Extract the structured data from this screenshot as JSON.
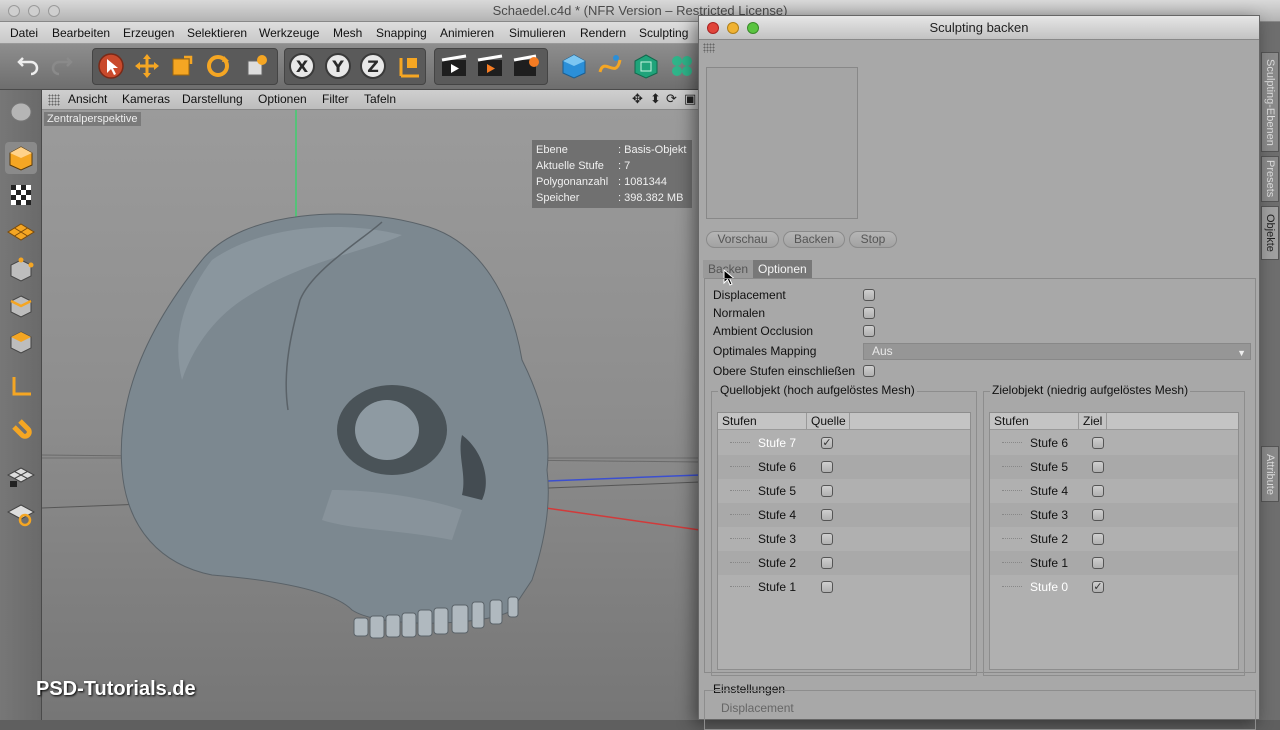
{
  "app": {
    "title": "Schaedel.c4d * (NFR Version – Restricted License)",
    "menu": [
      "Datei",
      "Bearbeiten",
      "Erzeugen",
      "Selektieren",
      "Werkzeuge",
      "Mesh",
      "Snapping",
      "Animieren",
      "Simulieren",
      "Rendern",
      "Sculpting"
    ],
    "toolbar_icons": [
      "undo-icon",
      "redo-icon",
      "select-icon",
      "move-icon",
      "scale-icon",
      "rotate-icon",
      "recent-tool-icon",
      "x-axis-icon",
      "y-axis-icon",
      "z-axis-icon",
      "coordinate-system-icon",
      "render-view-icon",
      "render-picture-icon",
      "render-settings-icon",
      "cube-icon",
      "spline-pen-icon",
      "subdivision-icon",
      "array-icon"
    ]
  },
  "viewport": {
    "menu": [
      "Ansicht",
      "Kameras",
      "Darstellung",
      "Optionen",
      "Filter",
      "Tafeln"
    ],
    "label": "Zentralperspektive",
    "hud": [
      {
        "key": "Ebene",
        "value": ": Basis-Objekt"
      },
      {
        "key": "Aktuelle Stufe",
        "value": ": 7"
      },
      {
        "key": "Polygonanzahl",
        "value": ": 1081344"
      },
      {
        "key": "Speicher",
        "value": ": 398.382 MB"
      }
    ]
  },
  "watermark": "PSD-Tutorials.de",
  "right_tabs": [
    "Sculpting-Ebenen",
    "Presets",
    "Objekte",
    "Attribute"
  ],
  "dialog": {
    "title": "Sculpting backen",
    "buttons": {
      "preview": "Vorschau",
      "bake": "Backen",
      "stop": "Stop"
    },
    "tabs": {
      "bake": "Backen",
      "options": "Optionen"
    },
    "options": {
      "displacement": "Displacement",
      "normals": "Normalen",
      "ao": "Ambient Occlusion",
      "mapping": "Optimales Mapping",
      "mapping_value": "Aus",
      "upper": "Obere Stufen einschließen"
    },
    "source": {
      "title": "Quellobjekt (hoch aufgelöstes Mesh)",
      "col1": "Stufen",
      "col2": "Quelle",
      "rows": [
        {
          "label": "Stufe 7",
          "checked": true
        },
        {
          "label": "Stufe 6",
          "checked": false
        },
        {
          "label": "Stufe 5",
          "checked": false
        },
        {
          "label": "Stufe 4",
          "checked": false
        },
        {
          "label": "Stufe 3",
          "checked": false
        },
        {
          "label": "Stufe 2",
          "checked": false
        },
        {
          "label": "Stufe 1",
          "checked": false
        }
      ]
    },
    "target": {
      "title": "Zielobjekt (niedrig aufgelöstes Mesh)",
      "col1": "Stufen",
      "col2": "Ziel",
      "rows": [
        {
          "label": "Stufe 6",
          "checked": false
        },
        {
          "label": "Stufe 5",
          "checked": false
        },
        {
          "label": "Stufe 4",
          "checked": false
        },
        {
          "label": "Stufe 3",
          "checked": false
        },
        {
          "label": "Stufe 2",
          "checked": false
        },
        {
          "label": "Stufe 1",
          "checked": false
        },
        {
          "label": "Stufe 0",
          "checked": true
        }
      ]
    },
    "settings": {
      "title": "Einstellungen",
      "sub": "Displacement"
    }
  },
  "colors": {
    "axis_x": "#c0392b",
    "axis_y": "#2ecc71",
    "axis_z": "#3b4fd0",
    "tool_orange": "#f39c12"
  }
}
